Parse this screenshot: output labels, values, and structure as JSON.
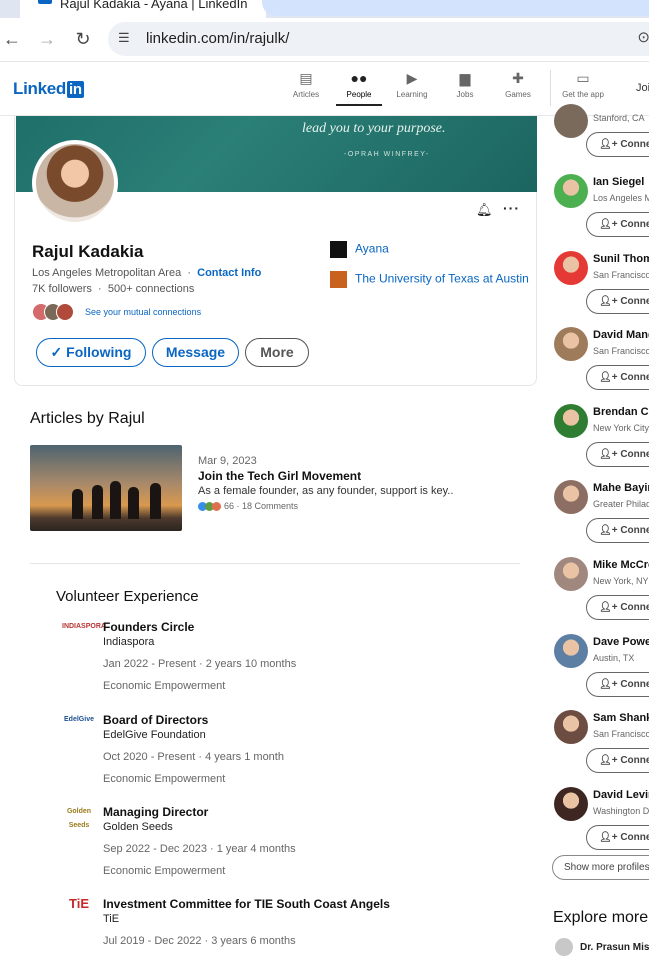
{
  "browser": {
    "tab_title": "Rajul Kadakia - Ayana | LinkedIn",
    "url": "linkedin.com/in/rajulk/"
  },
  "linkedin_header": {
    "logo_text": "Linked",
    "logo_in": "in",
    "nav": [
      {
        "label": "Articles",
        "icon": "articles-icon"
      },
      {
        "label": "People",
        "icon": "people-icon"
      },
      {
        "label": "Learning",
        "icon": "learning-icon"
      },
      {
        "label": "Jobs",
        "icon": "jobs-icon"
      },
      {
        "label": "Games",
        "icon": "games-icon"
      },
      {
        "label": "Get the app",
        "icon": "laptop-icon"
      }
    ],
    "join": "Joi"
  },
  "profile": {
    "banner_quote": "lead you to your purpose.",
    "banner_author": "-OPRAH WINFREY-",
    "name": "Rajul Kadakia",
    "location": "Los Angeles Metropolitan Area",
    "separator": "·",
    "contact_info": "Contact Info",
    "followers": "7K followers",
    "connections": "500+ connections",
    "mutual": "See your mutual connections",
    "btn_following": "✓ Following",
    "btn_message": "Message",
    "btn_more": "More",
    "orgs": [
      "Ayana",
      "The University of Texas at Austin"
    ]
  },
  "articles": {
    "heading": "Articles by Rajul",
    "item": {
      "date": "Mar 9, 2023",
      "title": "Join the Tech Girl Movement",
      "desc": "As a female founder, as any founder, support is key..",
      "reactions": "66 · 18 Comments"
    }
  },
  "volunteer": {
    "heading": "Volunteer Experience",
    "items": [
      {
        "role": "Founders Circle",
        "org": "Indiaspora",
        "dates": "Jan 2022 - Present · 2 years 10 months",
        "cause": "Economic Empowerment",
        "logo": "INDIASPORA"
      },
      {
        "role": "Board of Directors",
        "org": "EdelGive Foundation",
        "dates": "Oct 2020 - Present · 4 years 1 month",
        "cause": "Economic Empowerment",
        "logo": "EdelGive"
      },
      {
        "role": "Managing Director",
        "org": "Golden Seeds",
        "dates": "Sep 2022 - Dec 2023 · 1 year 4 months",
        "cause": "Economic Empowerment",
        "logo": "Golden Seeds"
      },
      {
        "role": "Investment Committee for TIE South Coast Angels",
        "org": "TiE",
        "dates": "Jul 2019 - Dec 2022 · 3 years 6 months",
        "cause": "",
        "logo": "TiE"
      }
    ]
  },
  "sidebar": {
    "first_loc": "Stanford, CA",
    "connect": "Connect",
    "people": [
      {
        "name": "Ian Siegel",
        "loc": "Los Angeles M",
        "color": "#4caf50"
      },
      {
        "name": "Sunil Thoma",
        "loc": "San Francisco",
        "color": "#e53935"
      },
      {
        "name": "David Mand",
        "loc": "San Francisco",
        "color": "#9e7b5a"
      },
      {
        "name": "Brendan Ca",
        "loc": "New York City",
        "color": "#2e7d32"
      },
      {
        "name": "Mahe Bayire",
        "loc": "Greater Philad",
        "color": "#8d6e63"
      },
      {
        "name": "Mike McCre",
        "loc": "New York, NY",
        "color": "#a1887f"
      },
      {
        "name": "Dave Powel",
        "loc": "Austin, TX",
        "color": "#5c7fa3"
      },
      {
        "name": "Sam Shank",
        "loc": "San Francisco",
        "color": "#6d4c41"
      },
      {
        "name": "David Levin",
        "loc": "Washington D",
        "color": "#3e2723"
      }
    ],
    "show_more": "Show more profiles",
    "explore": "Explore more",
    "explore_person": "Dr. Prasun Mishr"
  }
}
